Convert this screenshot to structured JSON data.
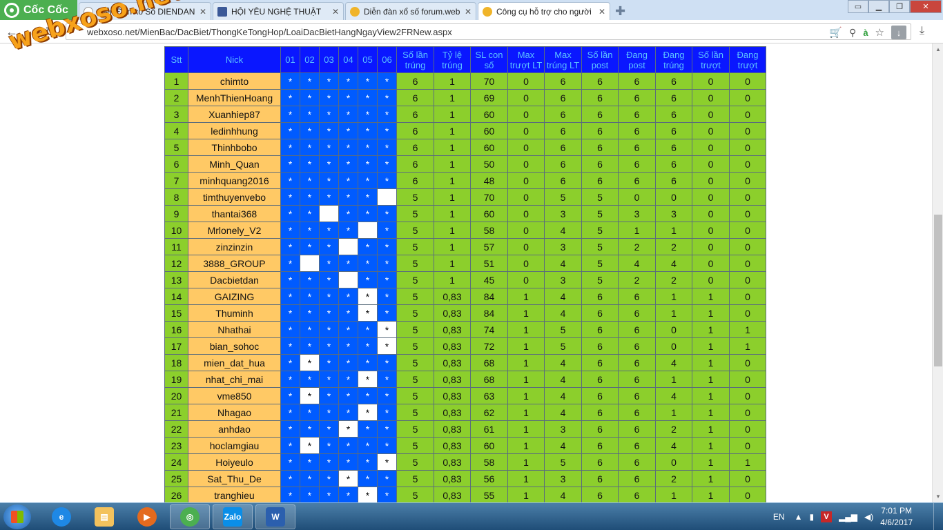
{
  "browser": {
    "brand": "Cốc Cốc",
    "tabs": [
      {
        "title": "Diễn Đàn xổ Số DIENDAN",
        "active": false,
        "favicon_color": "#ffffff"
      },
      {
        "title": "HỘI YÊU NGHỆ THUẬT",
        "active": false,
        "favicon_color": "#3b5998"
      },
      {
        "title": "Diễn đàn xổ số forum.web",
        "active": false,
        "favicon_color": "#f0b429"
      },
      {
        "title": "Công cụ hỗ trợ cho người",
        "active": true,
        "favicon_color": "#f0b429"
      }
    ],
    "new_tab_icon": "plus-icon",
    "window_controls": [
      "user-icon",
      "minimize-icon",
      "maximize-icon",
      "close-icon"
    ],
    "url_prefix": "webxoso.net/",
    "url": "MienBac/DacBiet/ThongKeTongHop/LoaiDacBietHangNgayView2FRNew.aspx"
  },
  "watermark": "webxoso.net",
  "table": {
    "headers": [
      "Stt",
      "Nick",
      "01",
      "02",
      "03",
      "04",
      "05",
      "06",
      "Số lần trúng",
      "Tỷ lệ trúng",
      "SL con số",
      "Max trượt LT",
      "Max trúng LT",
      "Số lần post",
      "Đang post",
      "Đang trúng",
      "Số lần trượt",
      "Đang trượt"
    ],
    "rows": [
      {
        "stt": "1",
        "nick": "chimto",
        "marks": [
          "*",
          "*",
          "*",
          "*",
          "*",
          "*"
        ],
        "white": [
          0,
          0,
          0,
          0,
          0,
          0
        ],
        "stats": [
          "6",
          "1",
          "70",
          "0",
          "6",
          "6",
          "6",
          "6",
          "0",
          "0"
        ]
      },
      {
        "stt": "2",
        "nick": "MenhThienHoang",
        "marks": [
          "*",
          "*",
          "*",
          "*",
          "*",
          "*"
        ],
        "white": [
          0,
          0,
          0,
          0,
          0,
          0
        ],
        "stats": [
          "6",
          "1",
          "69",
          "0",
          "6",
          "6",
          "6",
          "6",
          "0",
          "0"
        ]
      },
      {
        "stt": "3",
        "nick": "Xuanhiep87",
        "marks": [
          "*",
          "*",
          "*",
          "*",
          "*",
          "*"
        ],
        "white": [
          0,
          0,
          0,
          0,
          0,
          0
        ],
        "stats": [
          "6",
          "1",
          "60",
          "0",
          "6",
          "6",
          "6",
          "6",
          "0",
          "0"
        ]
      },
      {
        "stt": "4",
        "nick": "ledinhhung",
        "marks": [
          "*",
          "*",
          "*",
          "*",
          "*",
          "*"
        ],
        "white": [
          0,
          0,
          0,
          0,
          0,
          0
        ],
        "stats": [
          "6",
          "1",
          "60",
          "0",
          "6",
          "6",
          "6",
          "6",
          "0",
          "0"
        ]
      },
      {
        "stt": "5",
        "nick": "Thinhbobo",
        "marks": [
          "*",
          "*",
          "*",
          "*",
          "*",
          "*"
        ],
        "white": [
          0,
          0,
          0,
          0,
          0,
          0
        ],
        "stats": [
          "6",
          "1",
          "60",
          "0",
          "6",
          "6",
          "6",
          "6",
          "0",
          "0"
        ]
      },
      {
        "stt": "6",
        "nick": "Minh_Quan",
        "marks": [
          "*",
          "*",
          "*",
          "*",
          "*",
          "*"
        ],
        "white": [
          0,
          0,
          0,
          0,
          0,
          0
        ],
        "stats": [
          "6",
          "1",
          "50",
          "0",
          "6",
          "6",
          "6",
          "6",
          "0",
          "0"
        ]
      },
      {
        "stt": "7",
        "nick": "minhquang2016",
        "marks": [
          "*",
          "*",
          "*",
          "*",
          "*",
          "*"
        ],
        "white": [
          0,
          0,
          0,
          0,
          0,
          0
        ],
        "stats": [
          "6",
          "1",
          "48",
          "0",
          "6",
          "6",
          "6",
          "6",
          "0",
          "0"
        ]
      },
      {
        "stt": "8",
        "nick": "timthuyenvebo",
        "marks": [
          "*",
          "*",
          "*",
          "*",
          "*",
          ""
        ],
        "white": [
          0,
          0,
          0,
          0,
          0,
          1
        ],
        "stats": [
          "5",
          "1",
          "70",
          "0",
          "5",
          "5",
          "0",
          "0",
          "0",
          "0"
        ]
      },
      {
        "stt": "9",
        "nick": "thantai368",
        "marks": [
          "*",
          "*",
          "",
          "*",
          "*",
          "*"
        ],
        "white": [
          0,
          0,
          1,
          0,
          0,
          0
        ],
        "stats": [
          "5",
          "1",
          "60",
          "0",
          "3",
          "5",
          "3",
          "3",
          "0",
          "0"
        ]
      },
      {
        "stt": "10",
        "nick": "Mrlonely_V2",
        "marks": [
          "*",
          "*",
          "*",
          "*",
          "",
          "*"
        ],
        "white": [
          0,
          0,
          0,
          0,
          1,
          0
        ],
        "stats": [
          "5",
          "1",
          "58",
          "0",
          "4",
          "5",
          "1",
          "1",
          "0",
          "0"
        ]
      },
      {
        "stt": "11",
        "nick": "zinzinzin",
        "marks": [
          "*",
          "*",
          "*",
          "",
          "*",
          "*"
        ],
        "white": [
          0,
          0,
          0,
          1,
          0,
          0
        ],
        "stats": [
          "5",
          "1",
          "57",
          "0",
          "3",
          "5",
          "2",
          "2",
          "0",
          "0"
        ]
      },
      {
        "stt": "12",
        "nick": "3888_GROUP",
        "marks": [
          "*",
          "",
          "*",
          "*",
          "*",
          "*"
        ],
        "white": [
          0,
          1,
          0,
          0,
          0,
          0
        ],
        "stats": [
          "5",
          "1",
          "51",
          "0",
          "4",
          "5",
          "4",
          "4",
          "0",
          "0"
        ]
      },
      {
        "stt": "13",
        "nick": "Dacbietdan",
        "marks": [
          "*",
          "*",
          "*",
          "",
          "*",
          "*"
        ],
        "white": [
          0,
          0,
          0,
          1,
          0,
          0
        ],
        "stats": [
          "5",
          "1",
          "45",
          "0",
          "3",
          "5",
          "2",
          "2",
          "0",
          "0"
        ]
      },
      {
        "stt": "14",
        "nick": "GAIZING",
        "marks": [
          "*",
          "*",
          "*",
          "*",
          "*",
          "*"
        ],
        "white": [
          0,
          0,
          0,
          0,
          1,
          0
        ],
        "stats": [
          "5",
          "0,83",
          "84",
          "1",
          "4",
          "6",
          "6",
          "1",
          "1",
          "0"
        ]
      },
      {
        "stt": "15",
        "nick": "Thuminh",
        "marks": [
          "*",
          "*",
          "*",
          "*",
          "*",
          "*"
        ],
        "white": [
          0,
          0,
          0,
          0,
          1,
          0
        ],
        "stats": [
          "5",
          "0,83",
          "84",
          "1",
          "4",
          "6",
          "6",
          "1",
          "1",
          "0"
        ]
      },
      {
        "stt": "16",
        "nick": "Nhathai",
        "marks": [
          "*",
          "*",
          "*",
          "*",
          "*",
          "*"
        ],
        "white": [
          0,
          0,
          0,
          0,
          0,
          1
        ],
        "stats": [
          "5",
          "0,83",
          "74",
          "1",
          "5",
          "6",
          "6",
          "0",
          "1",
          "1"
        ]
      },
      {
        "stt": "17",
        "nick": "bian_sohoc",
        "marks": [
          "*",
          "*",
          "*",
          "*",
          "*",
          "*"
        ],
        "white": [
          0,
          0,
          0,
          0,
          0,
          1
        ],
        "stats": [
          "5",
          "0,83",
          "72",
          "1",
          "5",
          "6",
          "6",
          "0",
          "1",
          "1"
        ]
      },
      {
        "stt": "18",
        "nick": "mien_dat_hua",
        "marks": [
          "*",
          "*",
          "*",
          "*",
          "*",
          "*"
        ],
        "white": [
          0,
          1,
          0,
          0,
          0,
          0
        ],
        "stats": [
          "5",
          "0,83",
          "68",
          "1",
          "4",
          "6",
          "6",
          "4",
          "1",
          "0"
        ]
      },
      {
        "stt": "19",
        "nick": "nhat_chi_mai",
        "marks": [
          "*",
          "*",
          "*",
          "*",
          "*",
          "*"
        ],
        "white": [
          0,
          0,
          0,
          0,
          1,
          0
        ],
        "stats": [
          "5",
          "0,83",
          "68",
          "1",
          "4",
          "6",
          "6",
          "1",
          "1",
          "0"
        ]
      },
      {
        "stt": "20",
        "nick": "vme850",
        "marks": [
          "*",
          "*",
          "*",
          "*",
          "*",
          "*"
        ],
        "white": [
          0,
          1,
          0,
          0,
          0,
          0
        ],
        "stats": [
          "5",
          "0,83",
          "63",
          "1",
          "4",
          "6",
          "6",
          "4",
          "1",
          "0"
        ]
      },
      {
        "stt": "21",
        "nick": "Nhagao",
        "marks": [
          "*",
          "*",
          "*",
          "*",
          "*",
          "*"
        ],
        "white": [
          0,
          0,
          0,
          0,
          1,
          0
        ],
        "stats": [
          "5",
          "0,83",
          "62",
          "1",
          "4",
          "6",
          "6",
          "1",
          "1",
          "0"
        ]
      },
      {
        "stt": "22",
        "nick": "anhdao",
        "marks": [
          "*",
          "*",
          "*",
          "*",
          "*",
          "*"
        ],
        "white": [
          0,
          0,
          0,
          1,
          0,
          0
        ],
        "stats": [
          "5",
          "0,83",
          "61",
          "1",
          "3",
          "6",
          "6",
          "2",
          "1",
          "0"
        ]
      },
      {
        "stt": "23",
        "nick": "hoclamgiau",
        "marks": [
          "*",
          "*",
          "*",
          "*",
          "*",
          "*"
        ],
        "white": [
          0,
          1,
          0,
          0,
          0,
          0
        ],
        "stats": [
          "5",
          "0,83",
          "60",
          "1",
          "4",
          "6",
          "6",
          "4",
          "1",
          "0"
        ]
      },
      {
        "stt": "24",
        "nick": "Hoiyeulo",
        "marks": [
          "*",
          "*",
          "*",
          "*",
          "*",
          "*"
        ],
        "white": [
          0,
          0,
          0,
          0,
          0,
          1
        ],
        "stats": [
          "5",
          "0,83",
          "58",
          "1",
          "5",
          "6",
          "6",
          "0",
          "1",
          "1"
        ]
      },
      {
        "stt": "25",
        "nick": "Sat_Thu_De",
        "marks": [
          "*",
          "*",
          "*",
          "*",
          "*",
          "*"
        ],
        "white": [
          0,
          0,
          0,
          1,
          0,
          0
        ],
        "stats": [
          "5",
          "0,83",
          "56",
          "1",
          "3",
          "6",
          "6",
          "2",
          "1",
          "0"
        ]
      },
      {
        "stt": "26",
        "nick": "tranghieu",
        "marks": [
          "*",
          "*",
          "*",
          "*",
          "*",
          "*"
        ],
        "white": [
          0,
          0,
          0,
          0,
          1,
          0
        ],
        "stats": [
          "5",
          "0,83",
          "55",
          "1",
          "4",
          "6",
          "6",
          "1",
          "1",
          "0"
        ]
      }
    ]
  },
  "colors": {
    "header_bg": "#0a17ff",
    "header_text": "#5cc3ff",
    "stt_bg": "#8ccf2c",
    "nick_bg": "#ffc965",
    "mark_bg": "#005bff",
    "stat_bg": "#8ccf2c"
  },
  "taskbar": {
    "apps": [
      "windows-explorer-icon",
      "internet-explorer-icon",
      "media-player-icon",
      "coccoc-icon",
      "zalo-icon",
      "word-icon"
    ],
    "zalo_label": "Zalo",
    "word_label": "W",
    "lang": "EN",
    "time": "7:01 PM",
    "date": "4/6/2017"
  }
}
